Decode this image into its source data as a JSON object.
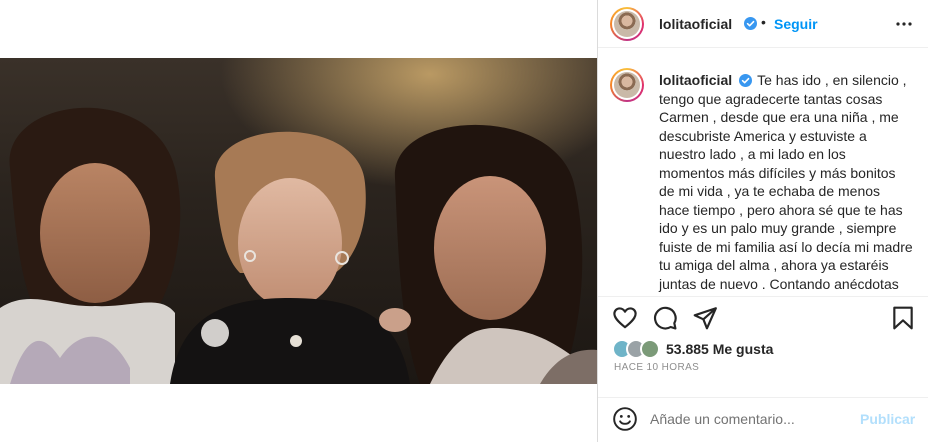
{
  "post": {
    "username": "lolitaoficial",
    "follow_label": "Seguir",
    "separator": "•",
    "caption": "Te has ido , en silencio , tengo que agradecerte tantas cosas Carmen , desde que era una niña , me descubriste America y estuviste a nuestro lado , a mi lado en los momentos más difíciles y más bonitos de mi vida , ya te echaba de menos hace tiempo , pero ahora sé que te has ido y es un palo muy grande , siempre fuiste de mi familia así lo decía mi madre tu amiga del alma , ahora ya estaréis juntas de nuevo . Contando anécdotas",
    "likes": "53.885 Me gusta",
    "timestamp": "HACE 10 HORAS"
  },
  "comment": {
    "placeholder": "Añade un comentario...",
    "publish_label": "Publicar"
  },
  "icons": {
    "verified": "verified-badge-icon",
    "more": "more-options-icon",
    "like": "heart-icon",
    "comment": "comment-icon",
    "share": "share-icon",
    "save": "bookmark-icon",
    "emoji": "emoji-icon"
  },
  "colors": {
    "link_blue": "#0095f6",
    "publish_disabled": "#b2dffc",
    "verified_blue": "#3897f0",
    "muted": "#8e8e8e"
  }
}
